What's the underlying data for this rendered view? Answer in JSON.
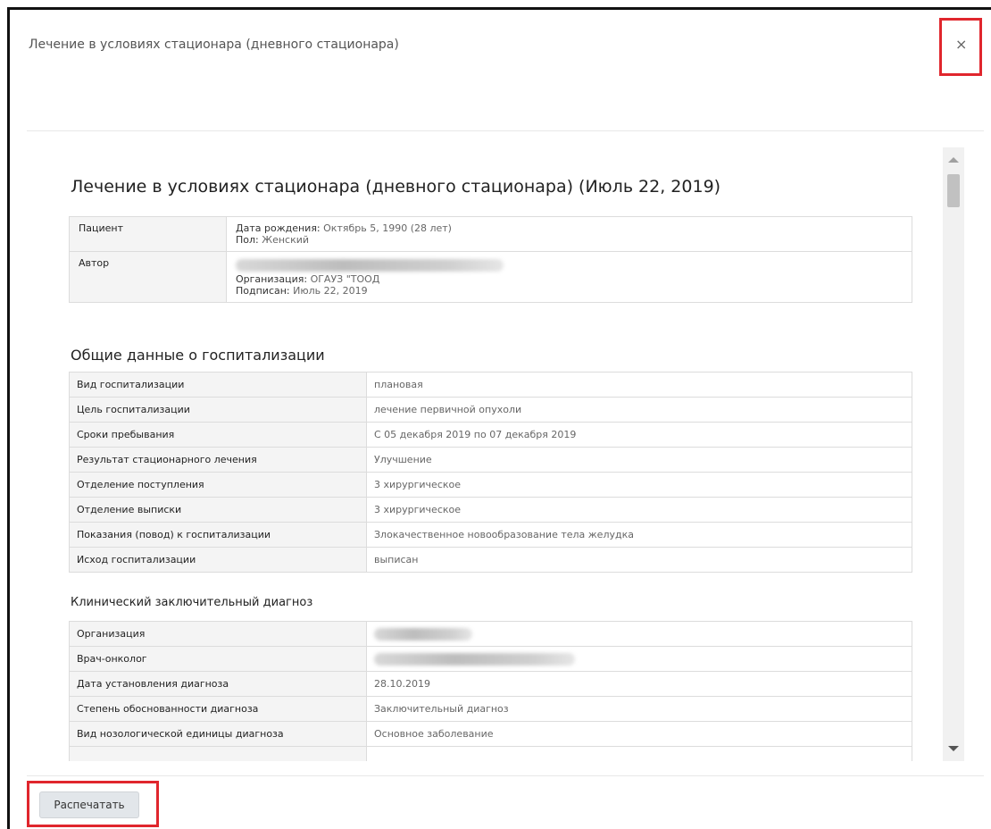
{
  "modal": {
    "title": "Лечение в условиях стационара (дневного стационара)",
    "close_label": "×",
    "print_label": "Распечатать"
  },
  "document": {
    "title": "Лечение в условиях стационара (дневного стационара) (Июль 22, 2019)",
    "patient": {
      "label": "Пациент",
      "birth_label": "Дата рождения:",
      "birth_value": "Октябрь 5, 1990 (28 лет)",
      "sex_label": "Пол:",
      "sex_value": "Женский"
    },
    "author": {
      "label": "Автор",
      "org_label": "Организация:",
      "org_value": "ОГАУЗ \"ТООД",
      "signed_label": "Подписан:",
      "signed_value": "Июль 22, 2019"
    },
    "hospitalization": {
      "heading": "Общие данные о госпитализации",
      "rows": [
        {
          "label": "Вид госпитализации",
          "value": "плановая"
        },
        {
          "label": "Цель госпитализации",
          "value": "лечение первичной опухоли"
        },
        {
          "label": "Сроки пребывания",
          "value": "С 05 декабря 2019 по 07 декабря 2019"
        },
        {
          "label": "Результат стационарного лечения",
          "value": "Улучшение"
        },
        {
          "label": "Отделение поступления",
          "value": "3 хирургическое"
        },
        {
          "label": "Отделение выписки",
          "value": "3 хирургическое"
        },
        {
          "label": "Показания (повод) к госпитализации",
          "value": "Злокачественное новообразование тела желудка"
        },
        {
          "label": "Исход госпитализации",
          "value": "выписан"
        }
      ]
    },
    "diagnosis": {
      "heading": "Клинический заключительный диагноз",
      "rows": [
        {
          "label": "Организация",
          "value": ""
        },
        {
          "label": "Врач-онколог",
          "value": ""
        },
        {
          "label": "Дата установления диагноза",
          "value": "28.10.2019"
        },
        {
          "label": "Степень обоснованности диагноза",
          "value": "Заключительный диагноз"
        },
        {
          "label": "Вид нозологической единицы диагноза",
          "value": "Основное заболевание"
        }
      ]
    }
  },
  "colors": {
    "highlight": "#e0262d",
    "button_bg": "#e2e6ea"
  }
}
